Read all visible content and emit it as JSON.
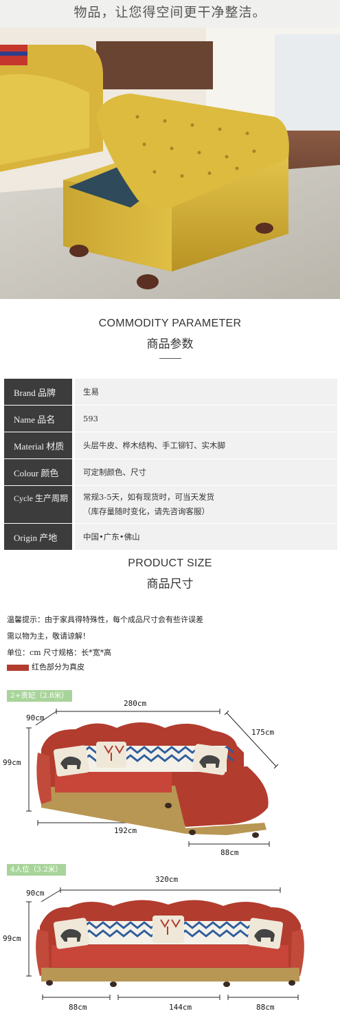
{
  "header": {
    "caption": "物品，让您得空间更干净整洁。"
  },
  "parameter_section": {
    "title_en": "COMMODITY PARAMETER",
    "title_cn": "商品参数"
  },
  "parameters": [
    {
      "label": "Brand 品牌",
      "value": "生易"
    },
    {
      "label": "Name 品名",
      "value": "593"
    },
    {
      "label": "Material 材质",
      "value": "头层牛皮、桦木结构、手工铆钉、实木脚"
    },
    {
      "label": "Colour 颜色",
      "value": "可定制颜色、尺寸"
    },
    {
      "label": "Cycle 生产周期",
      "value": "常规3-5天，如有现货时，可当天发货",
      "value2": "（库存量随时变化，请先咨询客服）"
    },
    {
      "label": "Origin 产地",
      "value": "中国•广东•佛山"
    }
  ],
  "size_section": {
    "title_en": "PRODUCT SIZE",
    "title_cn": "商品尺寸"
  },
  "notes": {
    "line1": "温馨提示：由于家具得特殊性，每个成品尺寸会有些许误差",
    "line2": "需以物为主，敬请谅解！",
    "line3": "单位：cm   尺寸规格：长*宽*高",
    "legend": "红色部分为真皮"
  },
  "sofa1": {
    "tag": "2+贵妃（2.8米）",
    "width": "280cm",
    "depth": "90cm",
    "chaise": "175cm",
    "height": "99cm",
    "bottom_left": "192cm",
    "bottom_right": "88cm"
  },
  "sofa2": {
    "tag": "4人位（3.2米）",
    "width": "320cm",
    "depth": "90cm",
    "height": "99cm",
    "bottom_left": "88cm",
    "bottom_mid": "144cm",
    "bottom_right": "88cm"
  },
  "colors": {
    "leather_red": "#b23c2e",
    "ottoman_yellow": "#d9b53a",
    "tag_green": "#a8d49a",
    "label_bg": "#3c3c3c"
  }
}
